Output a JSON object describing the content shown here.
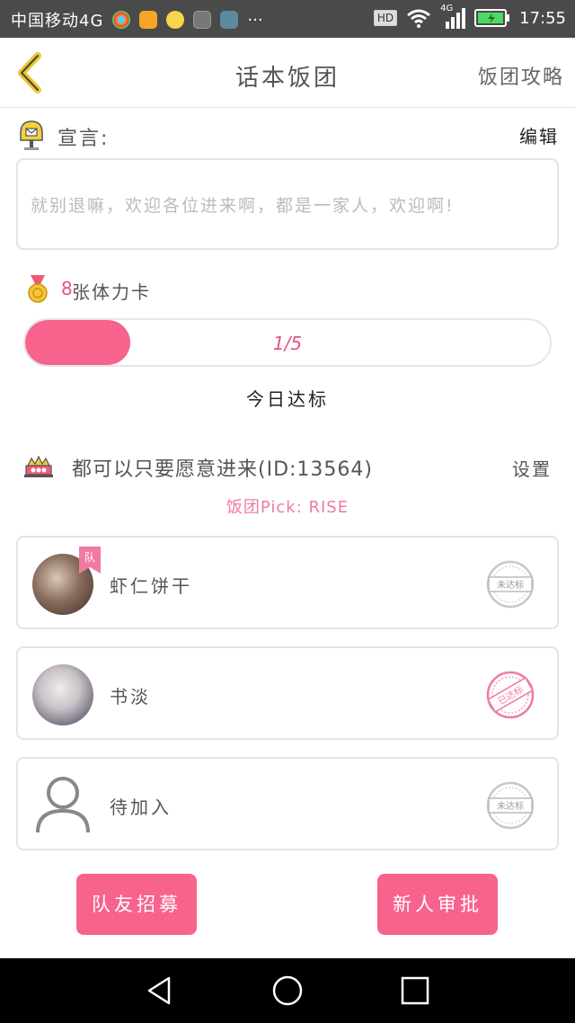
{
  "status_bar": {
    "carrier": "中国移动4G",
    "network": "4G",
    "hd": "HD",
    "time": "17:55",
    "more": "···"
  },
  "header": {
    "title": "话本饭团",
    "right_link": "饭团攻略"
  },
  "declaration": {
    "label": "宣言:",
    "edit": "编辑",
    "text": "就别退嘛，欢迎各位进来啊，都是一家人，欢迎啊!"
  },
  "stamina": {
    "count": "8",
    "label": "张体力卡",
    "progress_text": "1/5",
    "progress_value": 0.2,
    "today_label": "今日达标"
  },
  "group": {
    "name": "都可以只要愿意进来(ID:13564)",
    "settings": "设置",
    "pick": "饭团Pick: RISE"
  },
  "members": [
    {
      "name": "虾仁饼干",
      "badge": "队",
      "status": "未达标",
      "reached": false
    },
    {
      "name": "书淡",
      "status": "已达标",
      "reached": true
    },
    {
      "name": "待加入",
      "status": "未达标",
      "reached": false
    }
  ],
  "buttons": {
    "recruit": "队友招募",
    "approve": "新人审批"
  },
  "colors": {
    "accent": "#f7638d",
    "accent_text": "#e8527c",
    "status_bar": "#4a4a4a"
  }
}
